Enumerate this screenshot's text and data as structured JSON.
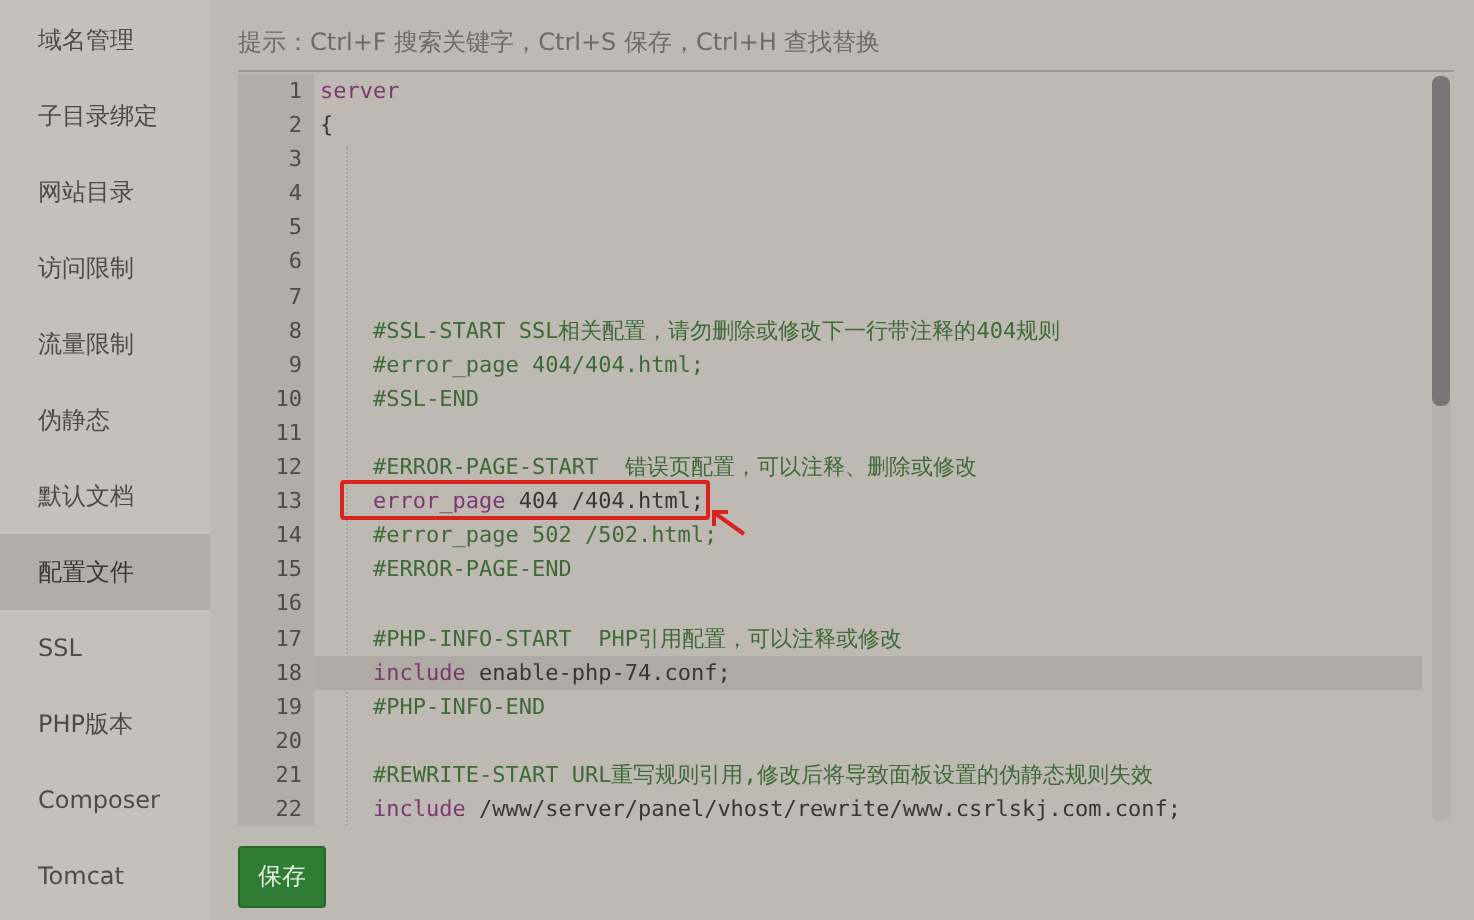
{
  "sidebar": {
    "items": [
      {
        "label": "域名管理",
        "selected": false
      },
      {
        "label": "子目录绑定",
        "selected": false
      },
      {
        "label": "网站目录",
        "selected": false
      },
      {
        "label": "访问限制",
        "selected": false
      },
      {
        "label": "流量限制",
        "selected": false
      },
      {
        "label": "伪静态",
        "selected": false
      },
      {
        "label": "默认文档",
        "selected": false
      },
      {
        "label": "配置文件",
        "selected": true
      },
      {
        "label": "SSL",
        "selected": false
      },
      {
        "label": "PHP版本",
        "selected": false
      },
      {
        "label": "Composer",
        "selected": false
      },
      {
        "label": "Tomcat",
        "selected": false
      }
    ]
  },
  "hint": "提示：Ctrl+F 搜索关键字，Ctrl+S 保存，Ctrl+H 查找替换",
  "editor": {
    "lines": [
      {
        "number": "1",
        "active": false,
        "marked": false,
        "tokens": [
          {
            "kind": "keyword",
            "text": "server"
          }
        ]
      },
      {
        "number": "2",
        "active": false,
        "marked": false,
        "tokens": [
          {
            "kind": "plain",
            "text": "{"
          }
        ]
      },
      {
        "number": "3",
        "active": false,
        "marked": false
      },
      {
        "number": "4",
        "active": false,
        "marked": false
      },
      {
        "number": "5",
        "active": false,
        "marked": false
      },
      {
        "number": "6",
        "active": false,
        "marked": false
      },
      {
        "number": "7",
        "active": false,
        "marked": false
      },
      {
        "number": "8",
        "active": false,
        "marked": false,
        "tokens": [
          {
            "kind": "comment",
            "text": "    #SSL-START SSL相关配置，请勿删除或修改下一行带注释的404规则"
          }
        ]
      },
      {
        "number": "9",
        "active": false,
        "marked": false,
        "tokens": [
          {
            "kind": "comment",
            "text": "    #error_page 404/404.html;"
          }
        ]
      },
      {
        "number": "10",
        "active": false,
        "marked": false,
        "tokens": [
          {
            "kind": "comment",
            "text": "    #SSL-END"
          }
        ]
      },
      {
        "number": "11",
        "active": false,
        "marked": false
      },
      {
        "number": "12",
        "active": false,
        "marked": false,
        "tokens": [
          {
            "kind": "comment",
            "text": "    #ERROR-PAGE-START  错误页配置，可以注释、删除或修改"
          }
        ]
      },
      {
        "number": "13",
        "active": false,
        "marked": true,
        "tokens": [
          {
            "kind": "keyword",
            "text": "    error_page"
          },
          {
            "kind": "plain",
            "text": " 404 /404.html;"
          }
        ]
      },
      {
        "number": "14",
        "active": false,
        "marked": false,
        "tokens": [
          {
            "kind": "comment",
            "text": "    #error_page 502 /502.html;"
          }
        ]
      },
      {
        "number": "15",
        "active": false,
        "marked": false,
        "tokens": [
          {
            "kind": "comment",
            "text": "    #ERROR-PAGE-END"
          }
        ]
      },
      {
        "number": "16",
        "active": false,
        "marked": false
      },
      {
        "number": "17",
        "active": false,
        "marked": false,
        "tokens": [
          {
            "kind": "comment",
            "text": "    #PHP-INFO-START  PHP引用配置，可以注释或修改"
          }
        ]
      },
      {
        "number": "18",
        "active": true,
        "marked": false,
        "tokens": [
          {
            "kind": "keyword",
            "text": "    include"
          },
          {
            "kind": "plain",
            "text": " enable-php-74.conf;"
          }
        ]
      },
      {
        "number": "19",
        "active": false,
        "marked": false,
        "tokens": [
          {
            "kind": "comment",
            "text": "    #PHP-INFO-END"
          }
        ]
      },
      {
        "number": "20",
        "active": false,
        "marked": false
      },
      {
        "number": "21",
        "active": false,
        "marked": false,
        "tokens": [
          {
            "kind": "comment",
            "text": "    #REWRITE-START URL重写规则引用,修改后将导致面板设置的伪静态规则失效"
          }
        ]
      },
      {
        "number": "22",
        "active": false,
        "marked": false,
        "tokens": [
          {
            "kind": "keyword",
            "text": "    include"
          },
          {
            "kind": "plain",
            "text": " /www/server/panel/vhost/rewrite/www.csrlskj.com.conf;"
          }
        ]
      }
    ]
  },
  "save_button": "保存"
}
